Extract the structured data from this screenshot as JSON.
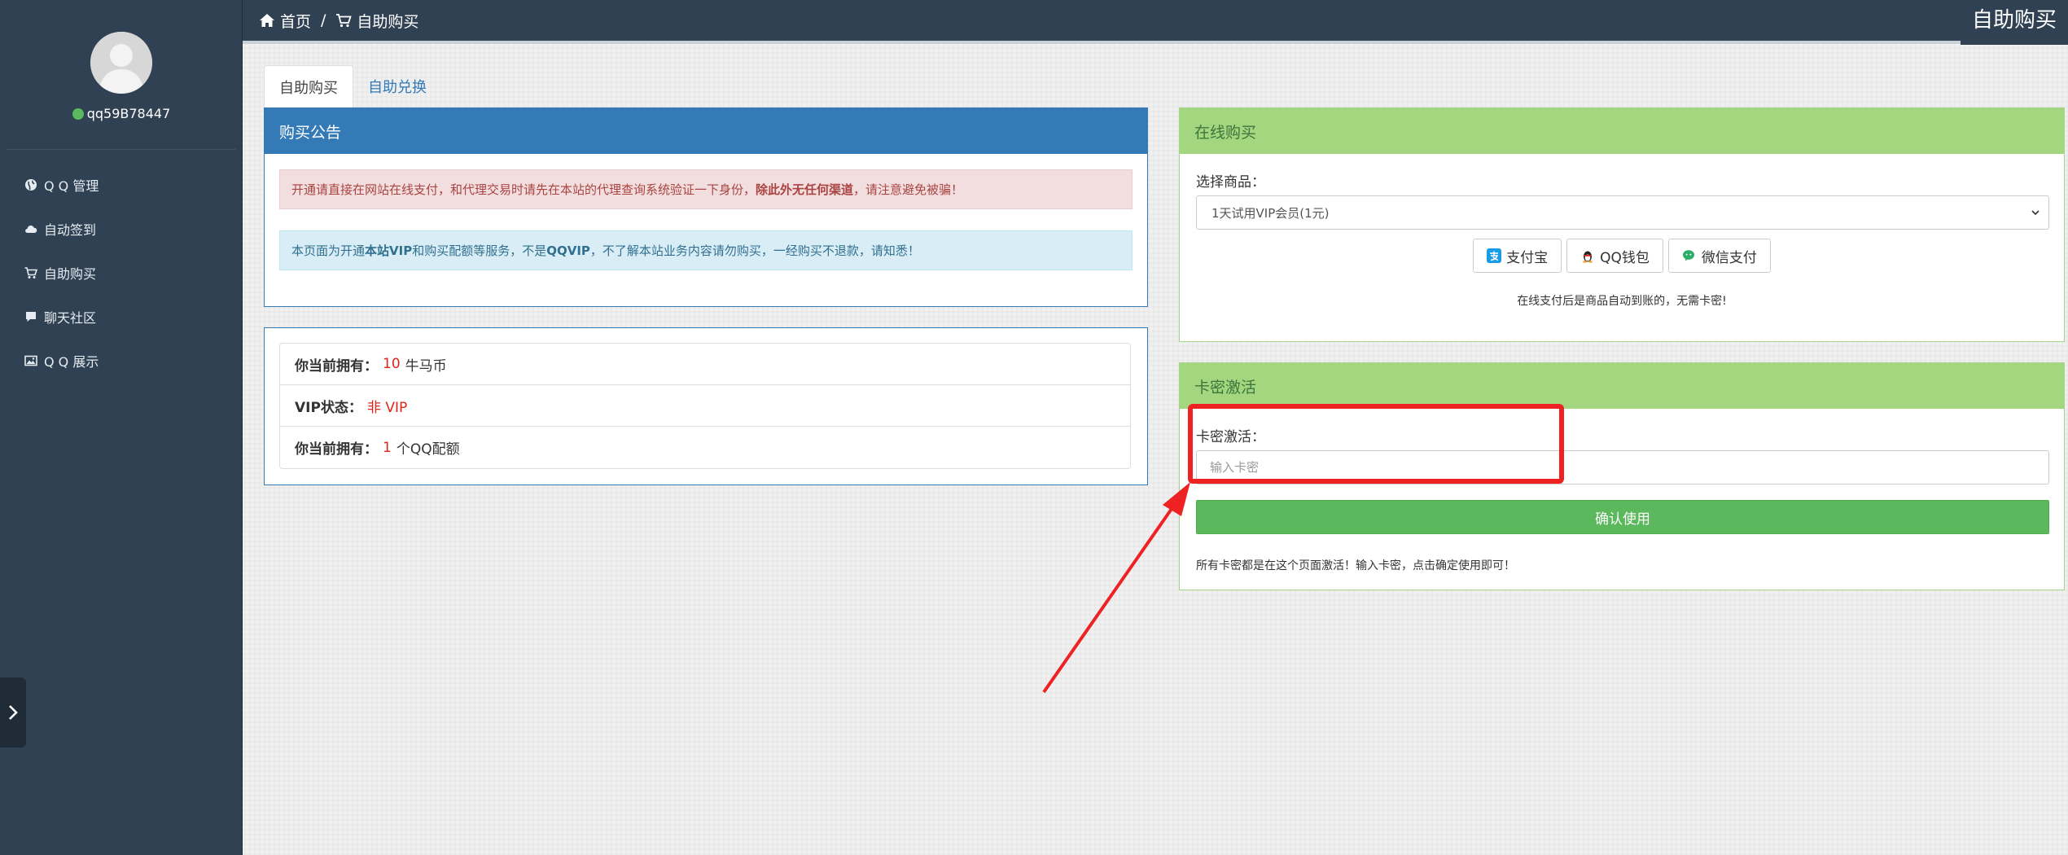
{
  "sidebar": {
    "username": "qq59B78447",
    "status_color": "#5cb85c",
    "items": [
      {
        "label": "Q Q 管理",
        "icon": "globe-icon"
      },
      {
        "label": "自动签到",
        "icon": "cloud-icon"
      },
      {
        "label": "自助购买",
        "icon": "cart-icon"
      },
      {
        "label": "聊天社区",
        "icon": "comment-icon"
      },
      {
        "label": "Q Q 展示",
        "icon": "image-icon"
      }
    ]
  },
  "topbar": {
    "breadcrumb": [
      {
        "label": "首页",
        "icon": "home-icon"
      },
      {
        "label": "自助购买",
        "icon": "cart-icon"
      }
    ],
    "separator": "/",
    "page_title": "自助购买"
  },
  "tabs": [
    {
      "label": "自助购买",
      "active": true
    },
    {
      "label": "自助兑换",
      "active": false
    }
  ],
  "notice": {
    "title": "购买公告",
    "danger_text_1": "开通请直接在网站在线支付，和代理交易时请先在本站的代理查询系统验证一下身份，",
    "danger_bold": "除此外无任何渠道",
    "danger_text_2": "，请注意避免被骗！",
    "info_text_1": "本页面为开通",
    "info_bold_1": "本站VIP",
    "info_text_2": "和购买配额等服务，不是",
    "info_bold_2": "QQVIP",
    "info_text_3": "，不了解本站业务内容请勿购买，一经购买不退款，请知悉！"
  },
  "account": {
    "rows": [
      {
        "label": "你当前拥有：",
        "value": "10",
        "suffix": "牛马币"
      },
      {
        "label": "VIP状态：",
        "value": "非 VIP",
        "suffix": ""
      },
      {
        "label": "你当前拥有：",
        "value": "1",
        "suffix": "个QQ配额"
      }
    ]
  },
  "online_purchase": {
    "title": "在线购买",
    "select_label": "选择商品：",
    "selected_product": "1天试用VIP会员(1元)",
    "payments": [
      {
        "label": "支付宝",
        "icon": "alipay-icon",
        "color": "#1a9be8"
      },
      {
        "label": "QQ钱包",
        "icon": "qq-penguin-icon",
        "color": "#333333"
      },
      {
        "label": "微信支付",
        "icon": "wechat-icon",
        "color": "#2aae67"
      }
    ],
    "note": "在线支付后是商品自动到账的，无需卡密!"
  },
  "card_activation": {
    "title": "卡密激活",
    "label": "卡密激活：",
    "placeholder": "输入卡密",
    "value": "",
    "confirm_label": "确认使用",
    "note": "所有卡密都是在这个页面激活！输入卡密，点击确定使用即可！"
  },
  "annotation_color": "#ee2222"
}
